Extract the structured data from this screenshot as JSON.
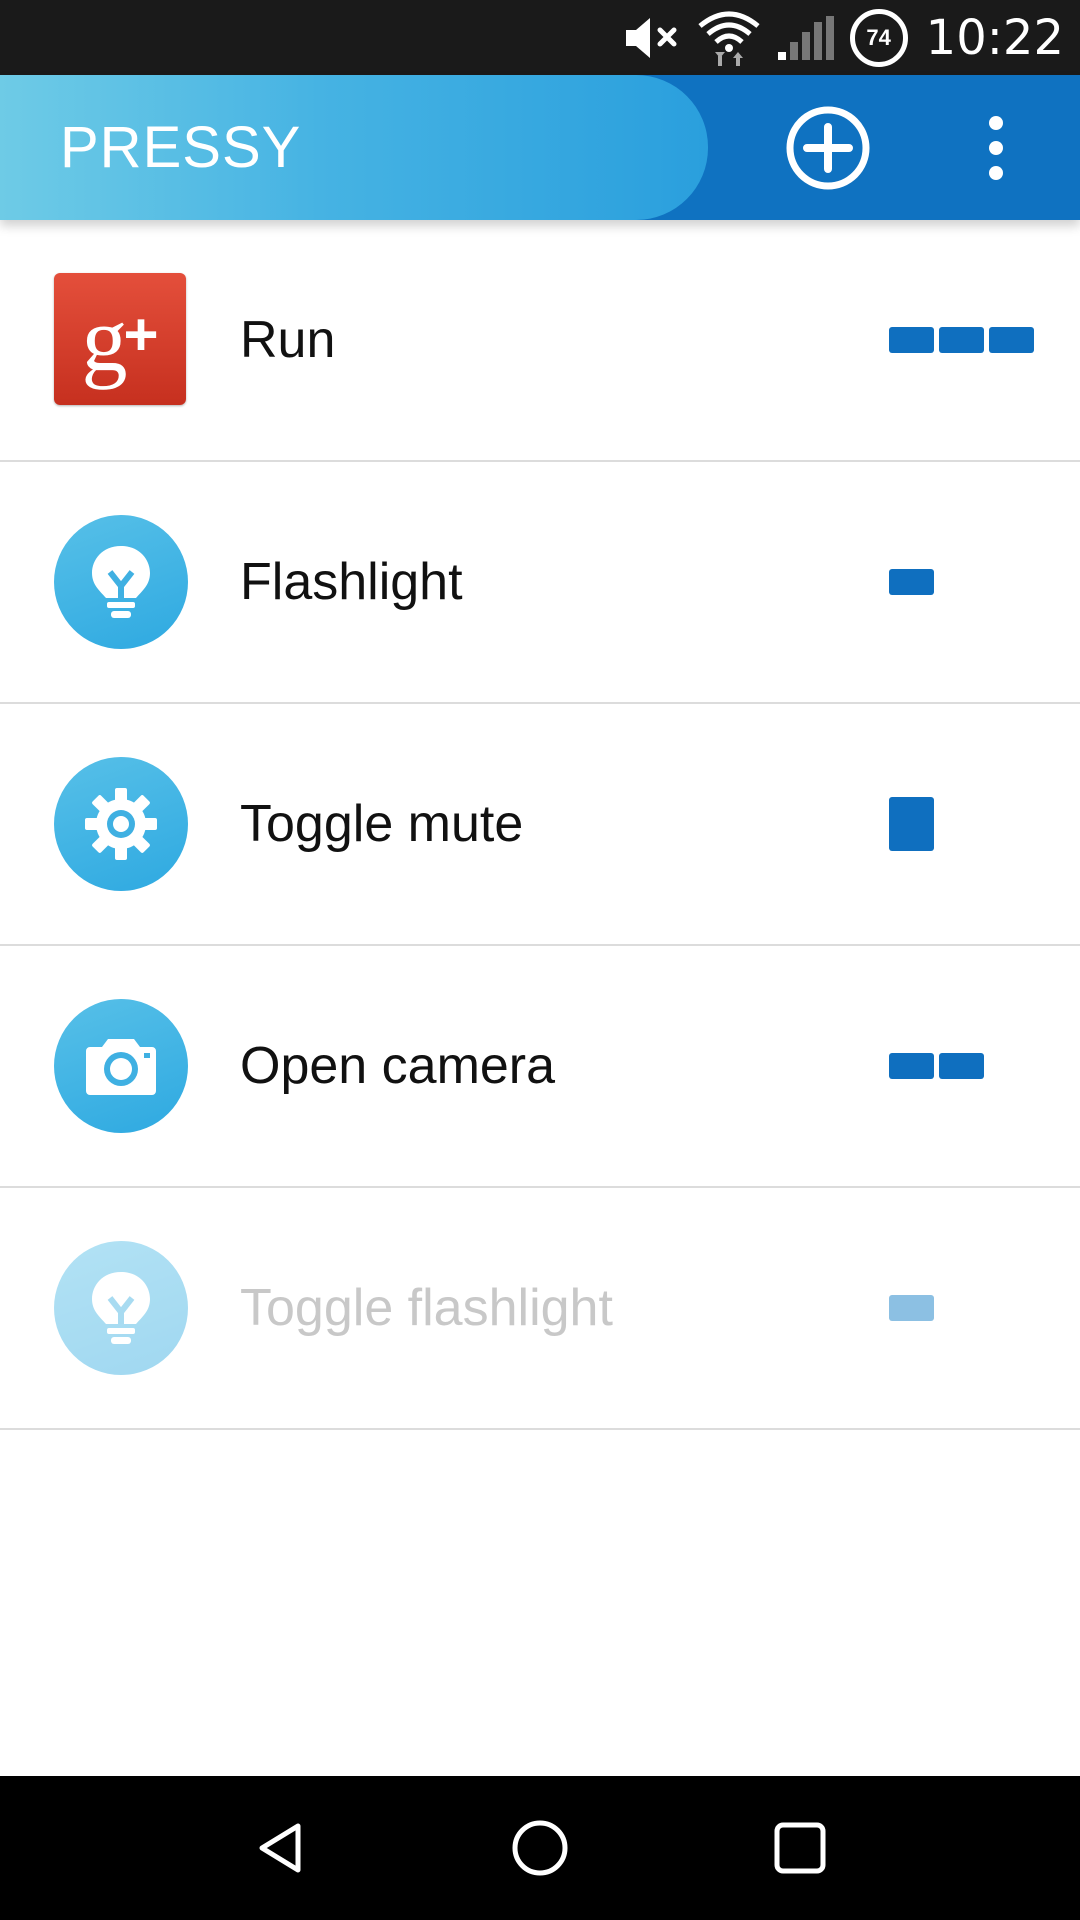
{
  "status_bar": {
    "icons": [
      "mute-icon",
      "wifi-icon",
      "signal-icon"
    ],
    "battery": "74",
    "time": "10:22"
  },
  "app_bar": {
    "title": "PRESSY",
    "add_icon": "add-circle-icon",
    "overflow_icon": "more-vert-icon",
    "accent_color": "#0f72c1",
    "tab_gradient": [
      "#6ecbe6",
      "#2a9fdd"
    ]
  },
  "actions": [
    {
      "label": "Run",
      "icon": "google-plus-icon",
      "pattern": [
        "short",
        "short",
        "short"
      ],
      "enabled": true
    },
    {
      "label": "Flashlight",
      "icon": "lightbulb-icon",
      "pattern": [
        "short"
      ],
      "enabled": true
    },
    {
      "label": "Toggle mute",
      "icon": "gear-icon",
      "pattern": [
        "long"
      ],
      "enabled": true
    },
    {
      "label": "Open camera",
      "icon": "camera-icon",
      "pattern": [
        "short",
        "short"
      ],
      "enabled": true
    },
    {
      "label": "Toggle flashlight",
      "icon": "lightbulb-icon",
      "pattern": [
        "short"
      ],
      "enabled": false
    }
  ],
  "nav_bar": {
    "back": "back-icon",
    "home": "home-icon",
    "recents": "recents-icon"
  }
}
